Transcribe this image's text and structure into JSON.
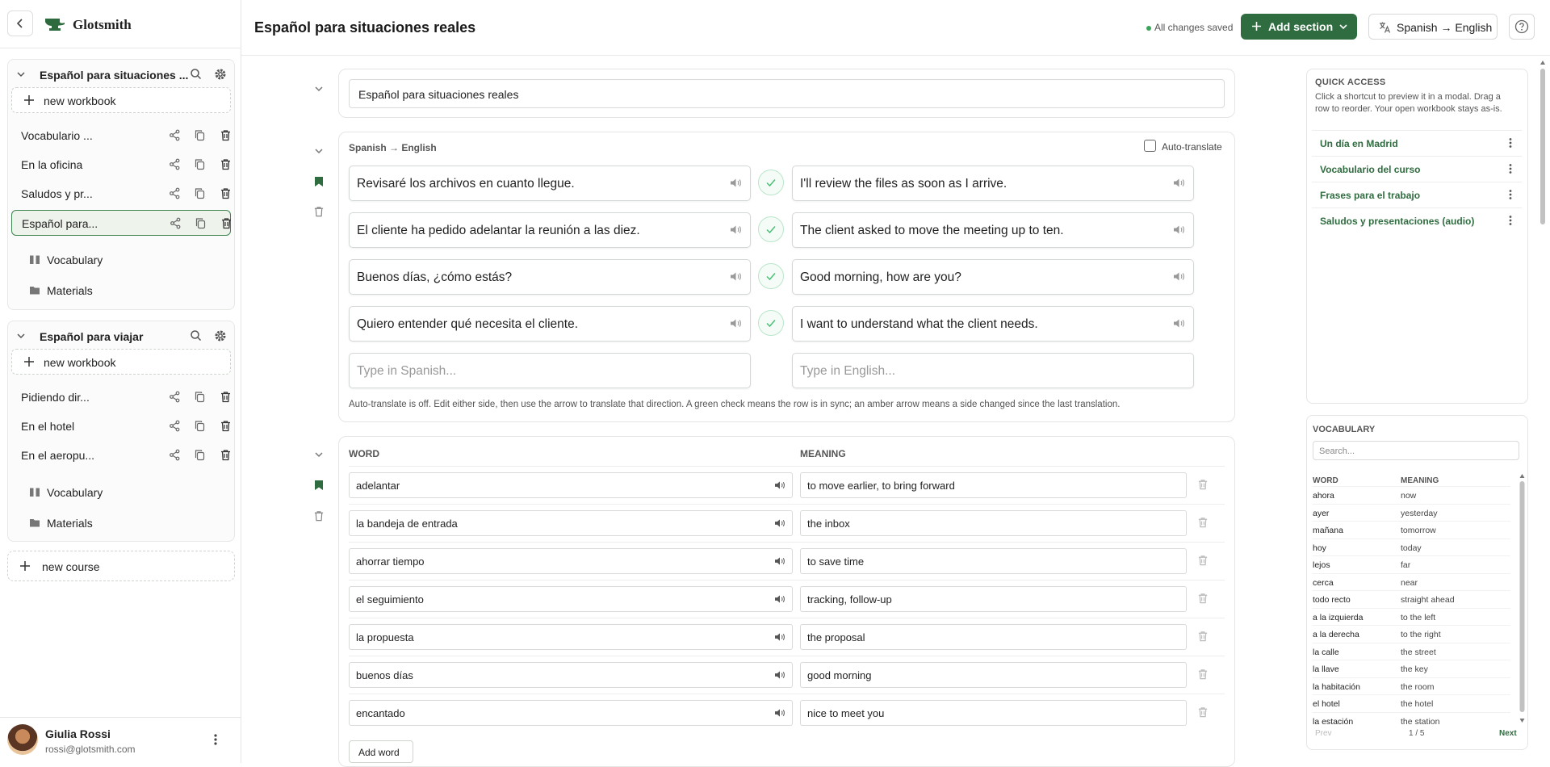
{
  "app": {
    "brand": "Glotsmith"
  },
  "sidebar": {
    "courses": [
      {
        "title": "Español para situaciones ...",
        "new_workbook": "new workbook",
        "workbooks": [
          {
            "label": "Vocabulario ..."
          },
          {
            "label": "En la oficina"
          },
          {
            "label": "Saludos y pr..."
          },
          {
            "label": "Español para..."
          }
        ],
        "links": [
          {
            "label": "Vocabulary"
          },
          {
            "label": "Materials"
          }
        ]
      },
      {
        "title": "Español para viajar",
        "new_workbook": "new workbook",
        "workbooks": [
          {
            "label": "Pidiendo dir..."
          },
          {
            "label": "En el hotel"
          },
          {
            "label": "En el aeropu..."
          }
        ],
        "links": [
          {
            "label": "Vocabulary"
          },
          {
            "label": "Materials"
          }
        ]
      }
    ],
    "new_course": "new course",
    "user": {
      "name": "Giulia Rossi",
      "email": "rossi@glotsmith.com"
    }
  },
  "header": {
    "title": "Español para situaciones reales",
    "status": "All changes saved",
    "add_section": "Add section",
    "language_pair": "Spanish → English"
  },
  "colors": {
    "brand_green": "#2f6c3f",
    "sync_green": "#4bbf78",
    "status_dot": "#3aa55a"
  },
  "title_section": {
    "value": "Español para situaciones reales"
  },
  "sentence_section": {
    "pair_label": "Spanish → English",
    "auto_translate_label": "Auto-translate",
    "auto_translate_checked": false,
    "rows": [
      {
        "source": "Revisaré los archivos en cuanto llegue.",
        "target": "I'll review the files as soon as I arrive."
      },
      {
        "source": "El cliente ha pedido adelantar la reunión a las diez.",
        "target": "The client asked to move the meeting up to ten."
      },
      {
        "source": "Buenos días, ¿cómo estás?",
        "target": "Good morning, how are you?"
      },
      {
        "source": "Quiero entender qué necesita el cliente.",
        "target": "I want to understand what the client needs."
      }
    ],
    "source_placeholder": "Type in Spanish...",
    "target_placeholder": "Type in English...",
    "hint": "Auto-translate is off. Edit either side, then use the arrow to translate that direction. A green check means the row is in sync; an amber arrow means a side changed since the last translation."
  },
  "word_section": {
    "word_header": "WORD",
    "meaning_header": "MEANING",
    "rows": [
      {
        "word": "adelantar",
        "meaning": "to move earlier, to bring forward"
      },
      {
        "word": "la bandeja de entrada",
        "meaning": "the inbox"
      },
      {
        "word": "ahorrar tiempo",
        "meaning": "to save time"
      },
      {
        "word": "el seguimiento",
        "meaning": "tracking, follow-up"
      },
      {
        "word": "la propuesta",
        "meaning": "the proposal"
      },
      {
        "word": "buenos días",
        "meaning": "good morning"
      },
      {
        "word": "encantado",
        "meaning": "nice to meet you"
      }
    ],
    "add_word": "Add word"
  },
  "quick_access": {
    "title": "QUICK ACCESS",
    "description": "Click a shortcut to preview it in a modal. Drag a row to reorder. Your open workbook stays as-is.",
    "items": [
      {
        "label": "Un día en Madrid"
      },
      {
        "label": "Vocabulario del curso"
      },
      {
        "label": "Frases para el trabajo"
      },
      {
        "label": "Saludos y presentaciones (audio)"
      }
    ]
  },
  "vocab_panel": {
    "title": "VOCABULARY",
    "search_placeholder": "Search...",
    "word_header": "WORD",
    "meaning_header": "MEANING",
    "rows": [
      {
        "word": "ahora",
        "meaning": "now"
      },
      {
        "word": "ayer",
        "meaning": "yesterday"
      },
      {
        "word": "mañana",
        "meaning": "tomorrow"
      },
      {
        "word": "hoy",
        "meaning": "today"
      },
      {
        "word": "lejos",
        "meaning": "far"
      },
      {
        "word": "cerca",
        "meaning": "near"
      },
      {
        "word": "todo recto",
        "meaning": "straight ahead"
      },
      {
        "word": "a la izquierda",
        "meaning": "to the left"
      },
      {
        "word": "a la derecha",
        "meaning": "to the right"
      },
      {
        "word": "la calle",
        "meaning": "the street"
      },
      {
        "word": "la llave",
        "meaning": "the key"
      },
      {
        "word": "la habitación",
        "meaning": "the room"
      },
      {
        "word": "el hotel",
        "meaning": "the hotel"
      },
      {
        "word": "la estación",
        "meaning": "the station"
      }
    ],
    "prev": "Prev",
    "page": "1 / 5",
    "next": "Next"
  }
}
